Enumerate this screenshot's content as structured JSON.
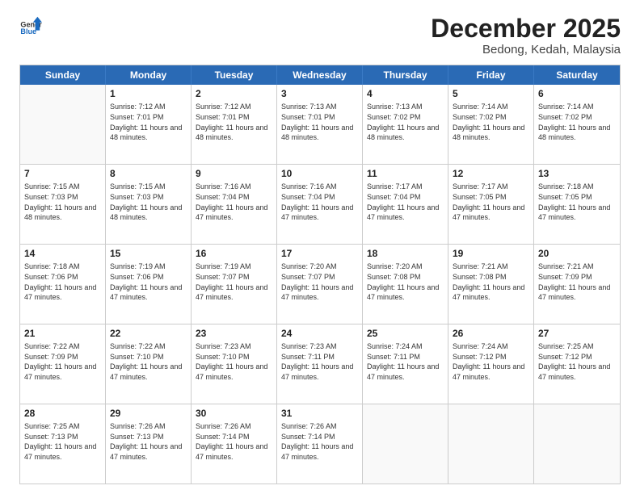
{
  "logo": {
    "general": "General",
    "blue": "Blue"
  },
  "title": "December 2025",
  "location": "Bedong, Kedah, Malaysia",
  "days": [
    "Sunday",
    "Monday",
    "Tuesday",
    "Wednesday",
    "Thursday",
    "Friday",
    "Saturday"
  ],
  "weeks": [
    [
      {
        "day": "",
        "sunrise": "",
        "sunset": "",
        "daylight": "",
        "empty": true
      },
      {
        "day": "1",
        "sunrise": "Sunrise: 7:12 AM",
        "sunset": "Sunset: 7:01 PM",
        "daylight": "Daylight: 11 hours and 48 minutes."
      },
      {
        "day": "2",
        "sunrise": "Sunrise: 7:12 AM",
        "sunset": "Sunset: 7:01 PM",
        "daylight": "Daylight: 11 hours and 48 minutes."
      },
      {
        "day": "3",
        "sunrise": "Sunrise: 7:13 AM",
        "sunset": "Sunset: 7:01 PM",
        "daylight": "Daylight: 11 hours and 48 minutes."
      },
      {
        "day": "4",
        "sunrise": "Sunrise: 7:13 AM",
        "sunset": "Sunset: 7:02 PM",
        "daylight": "Daylight: 11 hours and 48 minutes."
      },
      {
        "day": "5",
        "sunrise": "Sunrise: 7:14 AM",
        "sunset": "Sunset: 7:02 PM",
        "daylight": "Daylight: 11 hours and 48 minutes."
      },
      {
        "day": "6",
        "sunrise": "Sunrise: 7:14 AM",
        "sunset": "Sunset: 7:02 PM",
        "daylight": "Daylight: 11 hours and 48 minutes."
      }
    ],
    [
      {
        "day": "7",
        "sunrise": "Sunrise: 7:15 AM",
        "sunset": "Sunset: 7:03 PM",
        "daylight": "Daylight: 11 hours and 48 minutes."
      },
      {
        "day": "8",
        "sunrise": "Sunrise: 7:15 AM",
        "sunset": "Sunset: 7:03 PM",
        "daylight": "Daylight: 11 hours and 48 minutes."
      },
      {
        "day": "9",
        "sunrise": "Sunrise: 7:16 AM",
        "sunset": "Sunset: 7:04 PM",
        "daylight": "Daylight: 11 hours and 47 minutes."
      },
      {
        "day": "10",
        "sunrise": "Sunrise: 7:16 AM",
        "sunset": "Sunset: 7:04 PM",
        "daylight": "Daylight: 11 hours and 47 minutes."
      },
      {
        "day": "11",
        "sunrise": "Sunrise: 7:17 AM",
        "sunset": "Sunset: 7:04 PM",
        "daylight": "Daylight: 11 hours and 47 minutes."
      },
      {
        "day": "12",
        "sunrise": "Sunrise: 7:17 AM",
        "sunset": "Sunset: 7:05 PM",
        "daylight": "Daylight: 11 hours and 47 minutes."
      },
      {
        "day": "13",
        "sunrise": "Sunrise: 7:18 AM",
        "sunset": "Sunset: 7:05 PM",
        "daylight": "Daylight: 11 hours and 47 minutes."
      }
    ],
    [
      {
        "day": "14",
        "sunrise": "Sunrise: 7:18 AM",
        "sunset": "Sunset: 7:06 PM",
        "daylight": "Daylight: 11 hours and 47 minutes."
      },
      {
        "day": "15",
        "sunrise": "Sunrise: 7:19 AM",
        "sunset": "Sunset: 7:06 PM",
        "daylight": "Daylight: 11 hours and 47 minutes."
      },
      {
        "day": "16",
        "sunrise": "Sunrise: 7:19 AM",
        "sunset": "Sunset: 7:07 PM",
        "daylight": "Daylight: 11 hours and 47 minutes."
      },
      {
        "day": "17",
        "sunrise": "Sunrise: 7:20 AM",
        "sunset": "Sunset: 7:07 PM",
        "daylight": "Daylight: 11 hours and 47 minutes."
      },
      {
        "day": "18",
        "sunrise": "Sunrise: 7:20 AM",
        "sunset": "Sunset: 7:08 PM",
        "daylight": "Daylight: 11 hours and 47 minutes."
      },
      {
        "day": "19",
        "sunrise": "Sunrise: 7:21 AM",
        "sunset": "Sunset: 7:08 PM",
        "daylight": "Daylight: 11 hours and 47 minutes."
      },
      {
        "day": "20",
        "sunrise": "Sunrise: 7:21 AM",
        "sunset": "Sunset: 7:09 PM",
        "daylight": "Daylight: 11 hours and 47 minutes."
      }
    ],
    [
      {
        "day": "21",
        "sunrise": "Sunrise: 7:22 AM",
        "sunset": "Sunset: 7:09 PM",
        "daylight": "Daylight: 11 hours and 47 minutes."
      },
      {
        "day": "22",
        "sunrise": "Sunrise: 7:22 AM",
        "sunset": "Sunset: 7:10 PM",
        "daylight": "Daylight: 11 hours and 47 minutes."
      },
      {
        "day": "23",
        "sunrise": "Sunrise: 7:23 AM",
        "sunset": "Sunset: 7:10 PM",
        "daylight": "Daylight: 11 hours and 47 minutes."
      },
      {
        "day": "24",
        "sunrise": "Sunrise: 7:23 AM",
        "sunset": "Sunset: 7:11 PM",
        "daylight": "Daylight: 11 hours and 47 minutes."
      },
      {
        "day": "25",
        "sunrise": "Sunrise: 7:24 AM",
        "sunset": "Sunset: 7:11 PM",
        "daylight": "Daylight: 11 hours and 47 minutes."
      },
      {
        "day": "26",
        "sunrise": "Sunrise: 7:24 AM",
        "sunset": "Sunset: 7:12 PM",
        "daylight": "Daylight: 11 hours and 47 minutes."
      },
      {
        "day": "27",
        "sunrise": "Sunrise: 7:25 AM",
        "sunset": "Sunset: 7:12 PM",
        "daylight": "Daylight: 11 hours and 47 minutes."
      }
    ],
    [
      {
        "day": "28",
        "sunrise": "Sunrise: 7:25 AM",
        "sunset": "Sunset: 7:13 PM",
        "daylight": "Daylight: 11 hours and 47 minutes."
      },
      {
        "day": "29",
        "sunrise": "Sunrise: 7:26 AM",
        "sunset": "Sunset: 7:13 PM",
        "daylight": "Daylight: 11 hours and 47 minutes."
      },
      {
        "day": "30",
        "sunrise": "Sunrise: 7:26 AM",
        "sunset": "Sunset: 7:14 PM",
        "daylight": "Daylight: 11 hours and 47 minutes."
      },
      {
        "day": "31",
        "sunrise": "Sunrise: 7:26 AM",
        "sunset": "Sunset: 7:14 PM",
        "daylight": "Daylight: 11 hours and 47 minutes."
      },
      {
        "day": "",
        "sunrise": "",
        "sunset": "",
        "daylight": "",
        "empty": true
      },
      {
        "day": "",
        "sunrise": "",
        "sunset": "",
        "daylight": "",
        "empty": true
      },
      {
        "day": "",
        "sunrise": "",
        "sunset": "",
        "daylight": "",
        "empty": true
      }
    ]
  ]
}
